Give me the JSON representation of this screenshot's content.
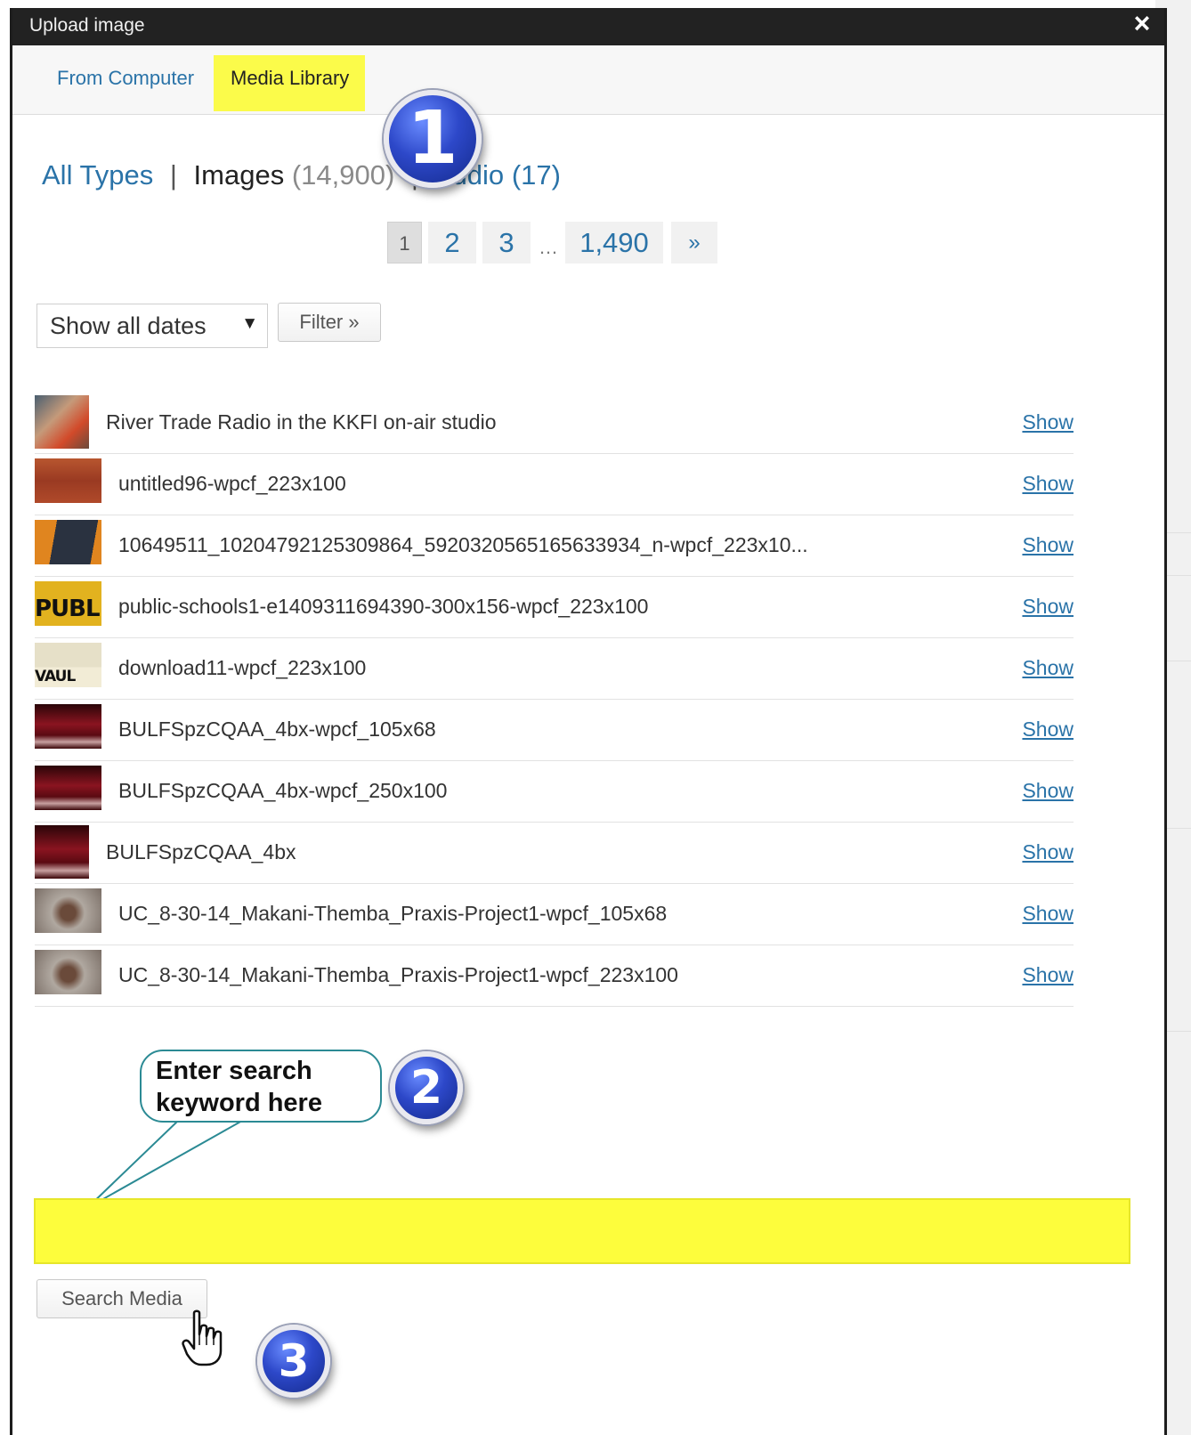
{
  "dialog": {
    "title": "Upload image",
    "close_icon": "×"
  },
  "tabs": [
    {
      "label": "From Computer"
    },
    {
      "label": "Media Library"
    }
  ],
  "type_filter": {
    "all_types": "All Types",
    "separator": "|",
    "images_label": "Images",
    "images_count": "(14,900)",
    "audio_label": "Audio",
    "audio_count": "(17)"
  },
  "pagination": {
    "current": "1",
    "pages": [
      "2",
      "3"
    ],
    "ellipsis": "…",
    "last": "1,490",
    "next": "»"
  },
  "date_filter": {
    "selected": "Show all dates",
    "arrow": "▼",
    "filter_button": "Filter »"
  },
  "media_items": [
    {
      "title": "River Trade Radio in the KKFI on-air studio",
      "action": "Show",
      "thumb_color": "#8a6a55"
    },
    {
      "title": "untitled96-wpcf_223x100",
      "action": "Show",
      "thumb_color": "#a8452a"
    },
    {
      "title": "10649511_10204792125309864_5920320565165633934_n-wpcf_223x10...",
      "action": "Show",
      "thumb_color": "#d8741e"
    },
    {
      "title": "public-schools1-e1409311694390-300x156-wpcf_223x100",
      "action": "Show",
      "thumb_color": "#e2b21f",
      "thumb_text": "PUBL"
    },
    {
      "title": "download11-wpcf_223x100",
      "action": "Show",
      "thumb_color": "#d9d2b8",
      "thumb_text": "VAUL"
    },
    {
      "title": "BULFSpzCQAA_4bx-wpcf_105x68",
      "action": "Show",
      "thumb_color": "#7a0a14"
    },
    {
      "title": "BULFSpzCQAA_4bx-wpcf_250x100",
      "action": "Show",
      "thumb_color": "#7a0a14"
    },
    {
      "title": "BULFSpzCQAA_4bx",
      "action": "Show",
      "thumb_color": "#7a0a14"
    },
    {
      "title": "UC_8-30-14_Makani-Themba_Praxis-Project1-wpcf_105x68",
      "action": "Show",
      "thumb_color": "#8c7f74"
    },
    {
      "title": "UC_8-30-14_Makani-Themba_Praxis-Project1-wpcf_223x100",
      "action": "Show",
      "thumb_color": "#8c7f74"
    }
  ],
  "annotations": {
    "step1": "1",
    "step2": "2",
    "step3": "3",
    "bubble_line1": "Enter search",
    "bubble_line2": "keyword here"
  },
  "search": {
    "value": "",
    "button_label": "Search Media"
  },
  "colors": {
    "link": "#2a73a8",
    "highlight": "#fdfd3c",
    "callout": "#2d48c9"
  }
}
